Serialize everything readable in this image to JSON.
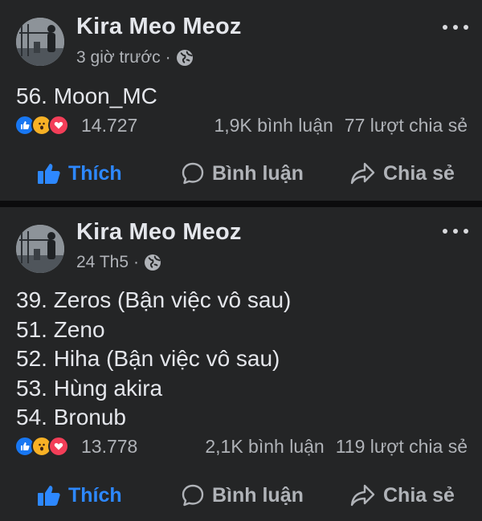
{
  "posts": [
    {
      "author": "Kira Meo Meoz",
      "time": "3 giờ trước",
      "separator": "·",
      "lines": [
        "56. Moon_MC"
      ],
      "reaction_count": "14.727",
      "comments": "1,9K bình luận",
      "shares": "77 lượt chia sẻ",
      "actions": {
        "like": "Thích",
        "comment": "Bình luận",
        "share": "Chia sẻ"
      }
    },
    {
      "author": "Kira Meo Meoz",
      "time": "24 Th5",
      "separator": "·",
      "lines": [
        "39. Zeros (Bận việc vô sau)",
        "51. Zeno",
        "52. Hiha (Bận việc vô sau)",
        "53. Hùng akira",
        "54. Bronub"
      ],
      "reaction_count": "13.778",
      "comments": "2,1K bình luận",
      "shares": "119 lượt chia sẻ",
      "actions": {
        "like": "Thích",
        "comment": "Bình luận",
        "share": "Chia sẻ"
      }
    }
  ],
  "icons": [
    "avatar",
    "globe-icon",
    "more-options-icon",
    "like-reaction-icon",
    "wow-reaction-icon",
    "love-reaction-icon",
    "thumbs-up-icon",
    "comment-bubble-icon",
    "share-arrow-icon"
  ],
  "colors": {
    "background": "#242526",
    "separator": "#0c0c0d",
    "text": "#e4e6eb",
    "muted": "#b0b3b8",
    "like_active": "#2d88ff"
  }
}
